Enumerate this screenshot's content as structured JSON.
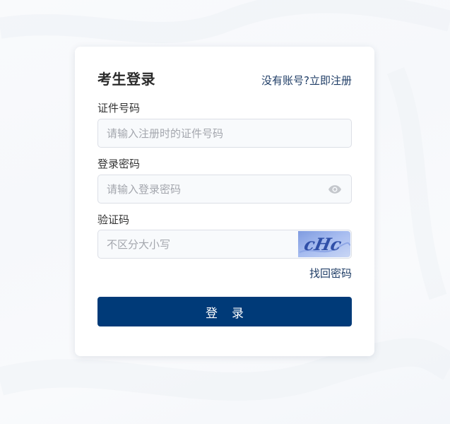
{
  "login": {
    "title": "考生登录",
    "register_link": "没有账号?立即注册",
    "id_label": "证件号码",
    "id_placeholder": "请输入注册时的证件号码",
    "password_label": "登录密码",
    "password_placeholder": "请输入登录密码",
    "captcha_label": "验证码",
    "captcha_placeholder": "不区分大小写",
    "captcha_text": "cHc",
    "forgot_link": "找回密码",
    "submit_label": "登录"
  },
  "icons": {
    "password_toggle": "eye-icon"
  },
  "colors": {
    "primary": "#003a78",
    "link": "#1f3d66",
    "input_border": "#dcdfe6",
    "input_bg": "#f8fafc",
    "placeholder": "#a3a6ad"
  }
}
